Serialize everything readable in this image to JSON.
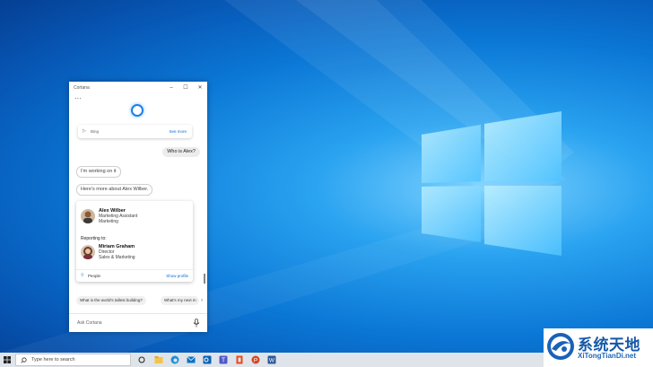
{
  "cortana": {
    "title": "Cortana",
    "window_controls": {
      "minimize": "–",
      "maximize": "☐",
      "close": "✕"
    },
    "more_label": "···",
    "bing_card": {
      "label": "Bing",
      "see_more": "See more"
    },
    "user_query": "Who is Alex?",
    "bot_messages": [
      "I'm working on it",
      "Here's more about Alex Wilber."
    ],
    "person_card": {
      "primary": {
        "name": "Alex Wilber",
        "title": "Marketing Assistant",
        "department": "Marketing"
      },
      "reporting_label": "Reporting to:",
      "manager": {
        "name": "Miriam Graham",
        "title": "Director",
        "department": "Sales & Marketing"
      },
      "footer_label": "People",
      "footer_link": "Show profile"
    },
    "suggestions": [
      "What is the world's tallest building?",
      "What's my next m"
    ],
    "ask_placeholder": "Ask Cortana"
  },
  "taskbar": {
    "search_placeholder": "Type here to search",
    "icons": [
      "task-view-icon",
      "file-explorer-icon",
      "edge-icon",
      "mail-icon",
      "outlook-icon",
      "teams-icon",
      "office-icon",
      "powerpoint-icon",
      "word-icon"
    ]
  },
  "watermark": {
    "title": "系统天地",
    "url": "XiTongTianDi.net"
  },
  "colors": {
    "accent": "#0a6cd0",
    "desktop": "#0b78d6"
  }
}
